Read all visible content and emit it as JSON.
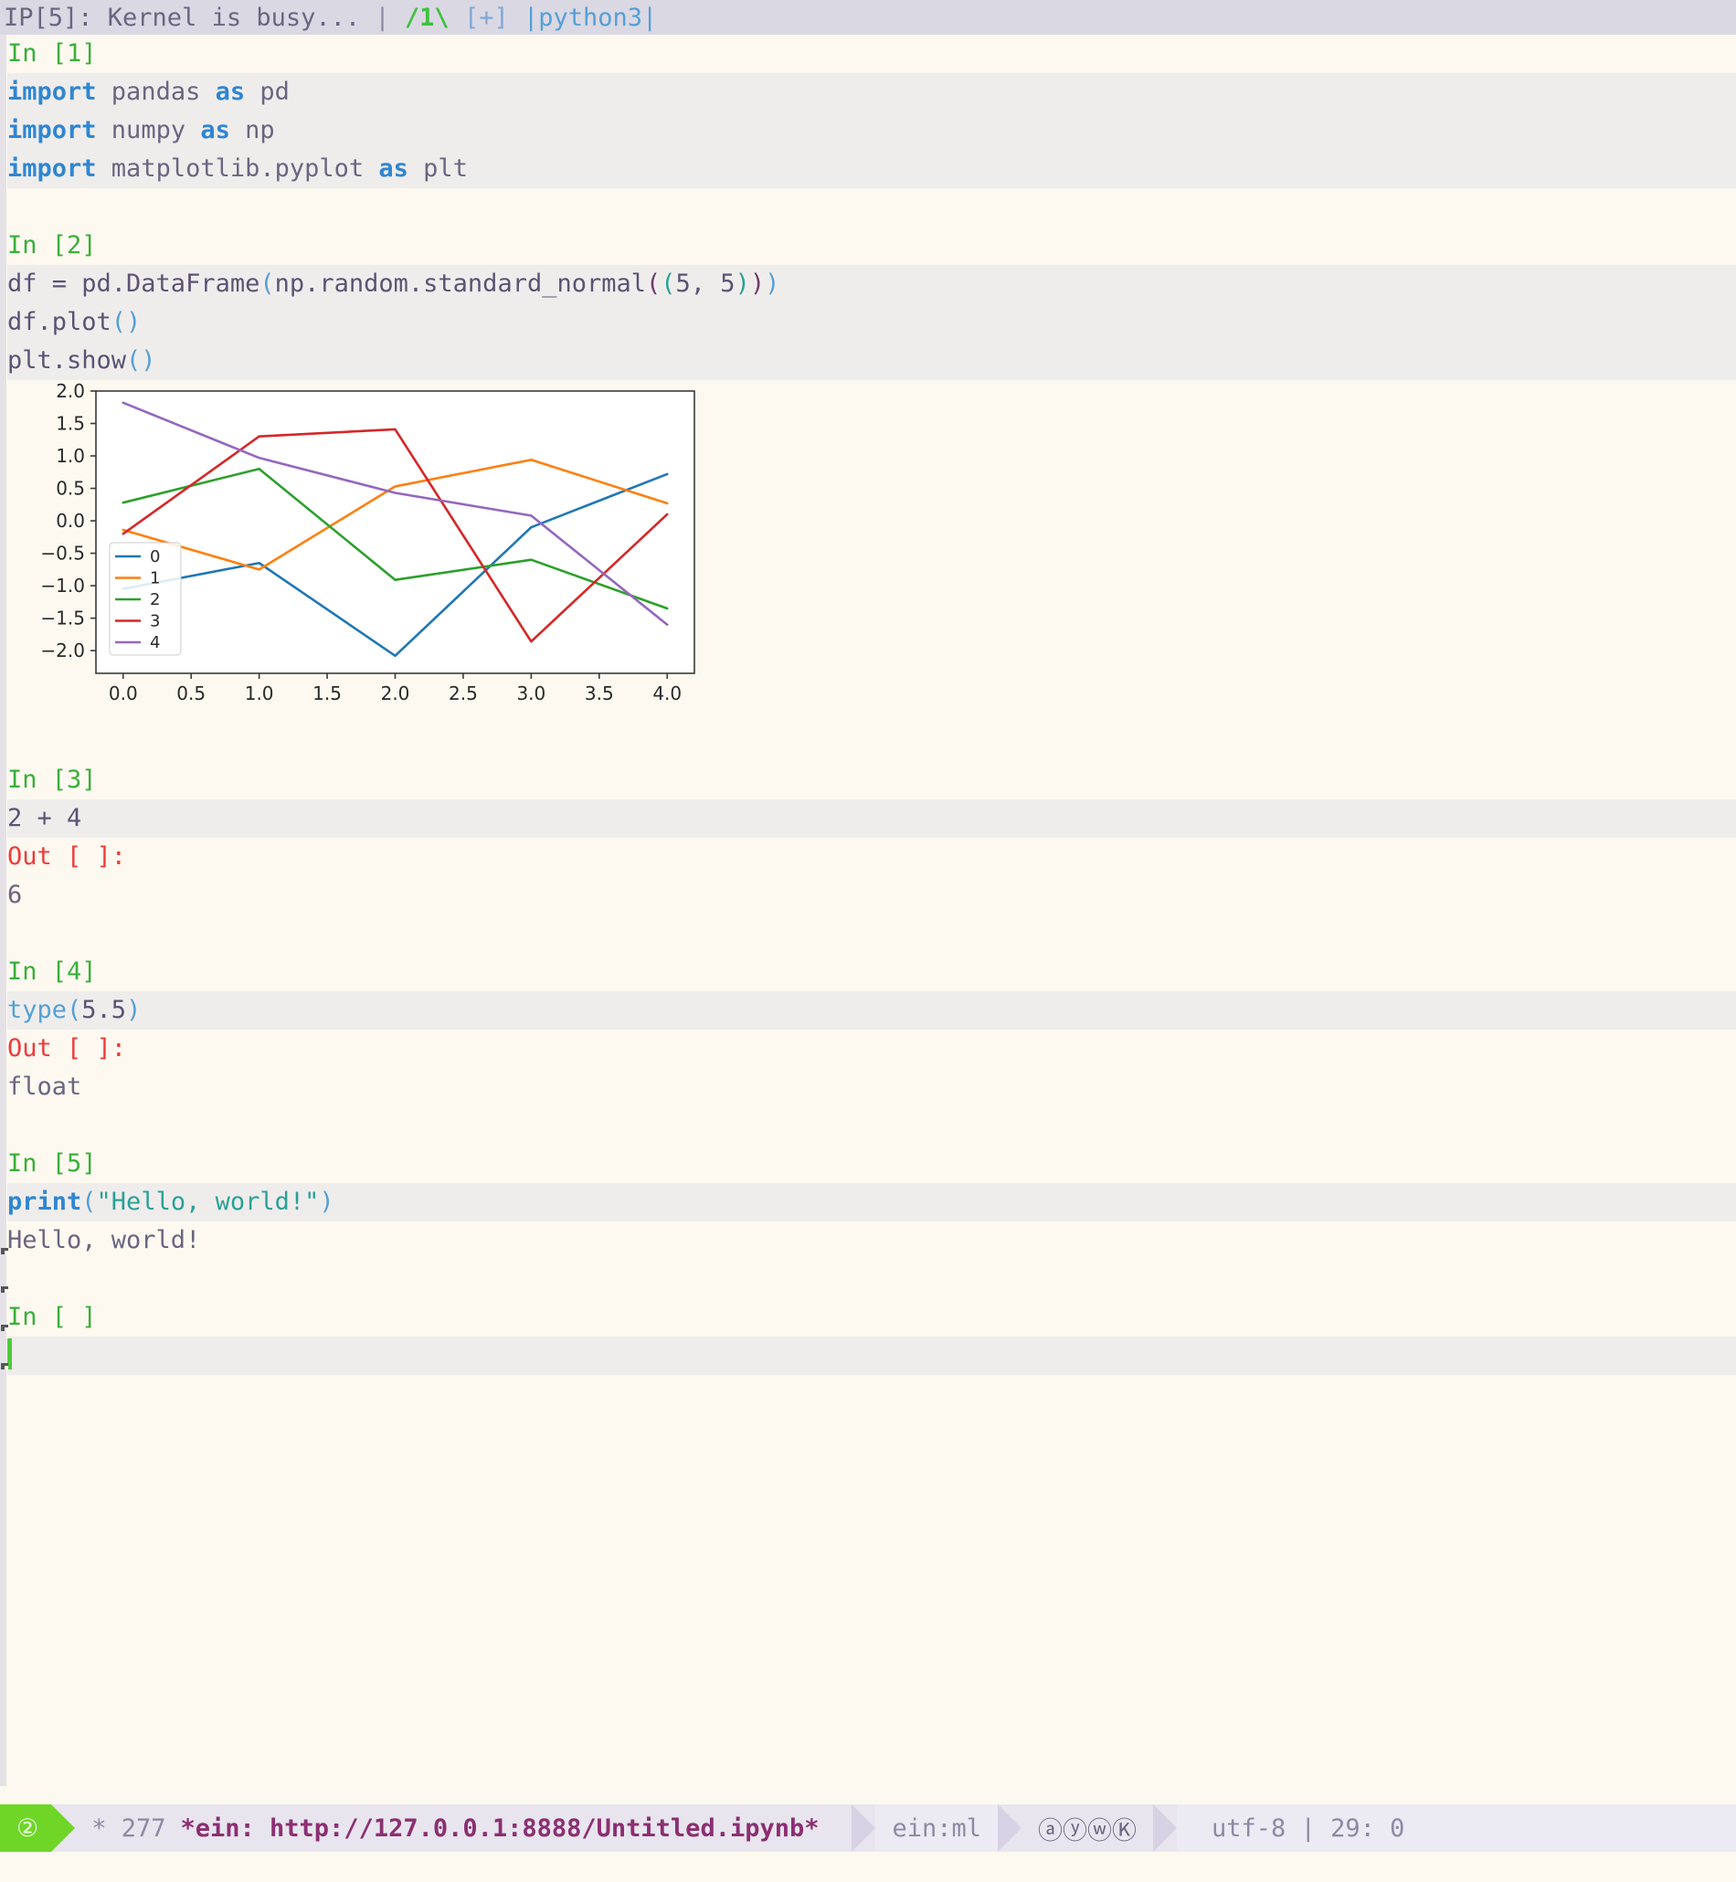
{
  "header": {
    "kernel_status": "IP[5]: Kernel is busy...",
    "sep1": " | ",
    "modified_indicator": "/1\\",
    "plus_indicator": "[+]",
    "kernel_name": "|python3|"
  },
  "cells": [
    {
      "prompt": "In [1]",
      "code_lines": [
        [
          {
            "t": "import",
            "c": "kw"
          },
          {
            "t": " pandas ",
            "c": "nm"
          },
          {
            "t": "as",
            "c": "kw"
          },
          {
            "t": " pd",
            "c": "nm"
          }
        ],
        [
          {
            "t": "import",
            "c": "kw"
          },
          {
            "t": " numpy ",
            "c": "nm"
          },
          {
            "t": "as",
            "c": "kw"
          },
          {
            "t": " np",
            "c": "nm"
          }
        ],
        [
          {
            "t": "import",
            "c": "kw"
          },
          {
            "t": " matplotlib.pyplot ",
            "c": "nm"
          },
          {
            "t": "as",
            "c": "kw"
          },
          {
            "t": " plt",
            "c": "nm"
          }
        ]
      ]
    },
    {
      "prompt": "In [2]",
      "code_lines": [
        [
          {
            "t": "df = pd.DataFrame",
            "c": "pv"
          },
          {
            "t": "(",
            "c": "fn"
          },
          {
            "t": "np.random.standard_normal",
            "c": "pv"
          },
          {
            "t": "(",
            "c": "ppurple"
          },
          {
            "t": "(",
            "c": "pgreen"
          },
          {
            "t": "5, 5",
            "c": "pv"
          },
          {
            "t": ")",
            "c": "pgreen"
          },
          {
            "t": ")",
            "c": "ppurple"
          },
          {
            "t": ")",
            "c": "fn"
          }
        ],
        [
          {
            "t": "df.plot",
            "c": "pv"
          },
          {
            "t": "()",
            "c": "fn"
          }
        ],
        [
          {
            "t": "plt.show",
            "c": "pv"
          },
          {
            "t": "()",
            "c": "fn"
          }
        ]
      ],
      "has_chart": true
    },
    {
      "prompt": "In [3]",
      "code_lines": [
        [
          {
            "t": "2 + 4",
            "c": "pv"
          }
        ]
      ],
      "out_prompt": "Out [ ]:",
      "out_text": "6"
    },
    {
      "prompt": "In [4]",
      "code_lines": [
        [
          {
            "t": "type",
            "c": "fn"
          },
          {
            "t": "(",
            "c": "fn"
          },
          {
            "t": "5.5",
            "c": "pv"
          },
          {
            "t": ")",
            "c": "fn"
          }
        ]
      ],
      "out_prompt": "Out [ ]:",
      "out_text": "float"
    },
    {
      "prompt": "In [5]",
      "code_lines": [
        [
          {
            "t": "print",
            "c": "builtin"
          },
          {
            "t": "(",
            "c": "fn"
          },
          {
            "t": "\"Hello, world!\"",
            "c": "str"
          },
          {
            "t": ")",
            "c": "fn"
          }
        ]
      ],
      "out_text": "Hello, world!"
    },
    {
      "prompt": "In [ ]",
      "code_lines": [
        []
      ],
      "cursor": true
    }
  ],
  "chart_data": {
    "type": "line",
    "title": "",
    "xlabel": "",
    "ylabel": "",
    "x": [
      0,
      1,
      2,
      3,
      4
    ],
    "xlim": [
      -0.2,
      4.2
    ],
    "ylim": [
      -2.35,
      2.0
    ],
    "xticks": [
      "0.0",
      "0.5",
      "1.0",
      "1.5",
      "2.0",
      "2.5",
      "3.0",
      "3.5",
      "4.0"
    ],
    "xtick_values": [
      0.0,
      0.5,
      1.0,
      1.5,
      2.0,
      2.5,
      3.0,
      3.5,
      4.0
    ],
    "yticks": [
      "2.0",
      "1.5",
      "1.0",
      "0.5",
      "0.0",
      "−0.5",
      "−1.0",
      "−1.5",
      "−2.0"
    ],
    "ytick_values": [
      2.0,
      1.5,
      1.0,
      0.5,
      0.0,
      -0.5,
      -1.0,
      -1.5,
      -2.0
    ],
    "grid": false,
    "legend_position": "lower left",
    "series": [
      {
        "name": "0",
        "color": "#1f77b4",
        "values": [
          -1.05,
          -0.65,
          -2.08,
          -0.1,
          0.72
        ]
      },
      {
        "name": "1",
        "color": "#ff7f0e",
        "values": [
          -0.14,
          -0.75,
          0.53,
          0.94,
          0.27
        ]
      },
      {
        "name": "2",
        "color": "#2ca02c",
        "values": [
          0.28,
          0.8,
          -0.91,
          -0.6,
          -1.35
        ]
      },
      {
        "name": "3",
        "color": "#d62728",
        "values": [
          -0.2,
          1.3,
          1.41,
          -1.86,
          0.1
        ]
      },
      {
        "name": "4",
        "color": "#9467bd",
        "values": [
          1.82,
          0.97,
          0.43,
          0.08,
          -1.6
        ]
      }
    ]
  },
  "modeline": {
    "window_number": "2",
    "line_info": "* 277",
    "buffer_name": "*ein: http://127.0.0.1:8888/Untitled.ipynb*",
    "major_mode": "ein:ml",
    "minor_modes": "ⓐⓨⓦⓀ",
    "coding": "utf-8 | 29: 0"
  }
}
